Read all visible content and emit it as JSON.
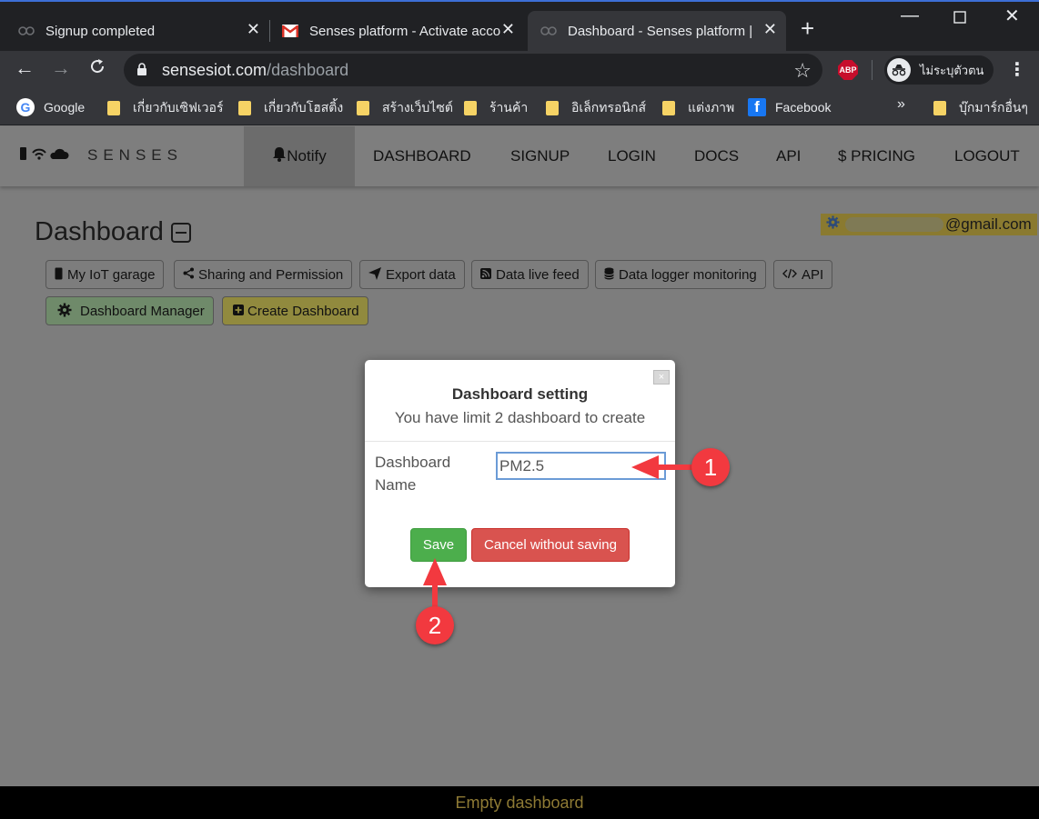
{
  "browser": {
    "tabs": [
      {
        "title": "Signup completed",
        "active": false
      },
      {
        "title": "Senses platform - Activate acco",
        "active": false
      },
      {
        "title": "Dashboard - Senses platform |",
        "active": true
      }
    ],
    "url_host": "sensesiot.com",
    "url_path": "/dashboard",
    "profile_label": "ไม่ระบุตัวตน",
    "abp_label": "ABP",
    "bookmarks": [
      "Google",
      "เกี่ยวกับเซิฟเวอร์",
      "เกี่ยวกับโฮสติ้ง",
      "สร้างเว็บไซต์",
      "ร้านค้า",
      "อิเล็กทรอนิกส์",
      "แต่งภาพ",
      "Facebook"
    ],
    "other_bookmarks": "บุ๊กมาร์กอื่นๆ"
  },
  "navbar": {
    "brand": "SENSES",
    "items": [
      "Notify",
      "DASHBOARD",
      "SIGNUP",
      "LOGIN",
      "DOCS",
      "API",
      "$ PRICING",
      "LOGOUT"
    ]
  },
  "user": {
    "email_suffix": "@gmail.com"
  },
  "dashboard": {
    "title": "Dashboard",
    "buttons": [
      "My IoT garage",
      "Sharing and Permission",
      "Export data",
      "Data live feed",
      "Data logger monitoring",
      "API",
      "Dashboard Manager",
      "Create Dashboard"
    ]
  },
  "modal": {
    "close": "×",
    "title": "Dashboard setting",
    "subtitle": "You have limit 2 dashboard to create",
    "field_label": "Dashboard Name",
    "field_value": "PM2.5",
    "save_label": "Save",
    "cancel_label": "Cancel without saving"
  },
  "annotations": [
    "1",
    "2"
  ],
  "footer": "Empty dashboard",
  "colors": {
    "save": "#4cae4c",
    "cancel": "#d9534f",
    "annotation": "#f2393f",
    "footer_text": "#8e7a34"
  }
}
